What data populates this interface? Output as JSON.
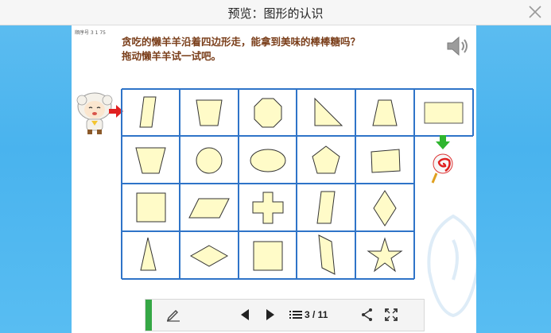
{
  "window": {
    "title": "预览：图形的认识"
  },
  "slide": {
    "tiny_label": "顺序号 3 1 75",
    "question_line1": "贪吃的懒羊羊沿着四边形走，能拿到美味的棒棒糖吗？",
    "question_line2": "拖动懒羊羊试一试吧。"
  },
  "grid": {
    "rows": [
      [
        "parallelogram-tall",
        "trapezoid-inverted",
        "octagon",
        "right-triangle",
        "trapezoid",
        "rectangle-wide"
      ],
      [
        "trapezoid-inverted",
        "circle",
        "ellipse",
        "pentagon",
        "quadrilateral-irregular",
        ""
      ],
      [
        "square",
        "parallelogram-slanted",
        "cross",
        "parallelogram-tall",
        "rhombus",
        ""
      ],
      [
        "triangle-isosceles",
        "rhombus-wide",
        "square",
        "parallelogram-tall-narrow",
        "star",
        ""
      ]
    ],
    "border_color": "#2f74c8",
    "shape_fill": "#fffbc8"
  },
  "toolbar": {
    "page_indicator": "3 / 11",
    "icons": [
      "pencil-icon",
      "prev-icon",
      "next-icon",
      "list-icon",
      "share-icon",
      "fullscreen-icon"
    ]
  },
  "colors": {
    "stage_blue": "#49b3ee",
    "question_brown": "#7a3e1a",
    "arrow_red": "#e02020",
    "arrow_green": "#2fb52f"
  }
}
